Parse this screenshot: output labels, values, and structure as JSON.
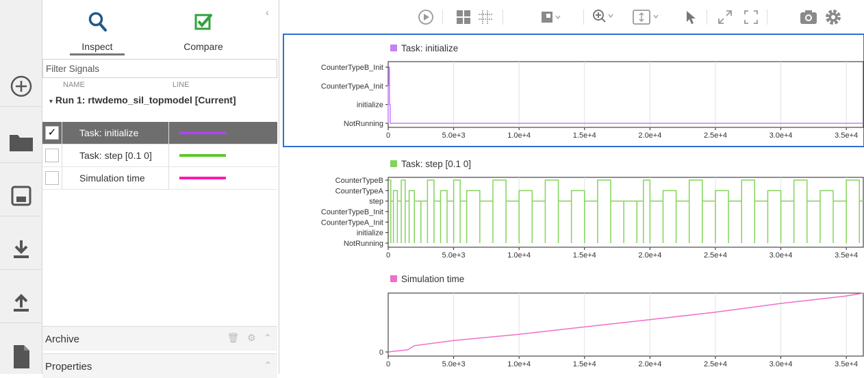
{
  "tabs": [
    {
      "label": "Inspect",
      "icon": "magnifier-icon"
    },
    {
      "label": "Compare",
      "icon": "checkbox-compare-icon"
    }
  ],
  "filter": {
    "placeholder": "Filter Signals"
  },
  "columns": {
    "name": "NAME",
    "line": "LINE"
  },
  "run": {
    "label": "Run 1: rtwdemo_sil_topmodel [Current]"
  },
  "signals": [
    {
      "name": "Task: initialize",
      "checked": true,
      "selected": true,
      "color": "#b044f0"
    },
    {
      "name": "Task: step [0.1 0]",
      "checked": false,
      "selected": false,
      "color": "#5cc92a"
    },
    {
      "name": "Simulation time",
      "checked": false,
      "selected": false,
      "color": "#ff1aa8"
    }
  ],
  "sections": {
    "archive": "Archive",
    "properties": "Properties"
  },
  "rail_icons": [
    "add-circle-icon",
    "folder-icon",
    "save-icon",
    "download-icon",
    "upload-icon",
    "document-icon"
  ],
  "toolbar_icons": [
    "play-icon",
    "layout-grid-icon",
    "subplot-layout-icon",
    "stream-visual-icon",
    "zoom-in-icon",
    "fit-to-view-icon",
    "cursor-icon",
    "expand-icon",
    "fullscreen-icon",
    "snapshot-icon",
    "settings-icon"
  ],
  "chart_data": [
    {
      "type": "line",
      "title": "Task: initialize",
      "color": "#c580f5",
      "selected": true,
      "xlim": [
        0,
        36300
      ],
      "x_ticks": [
        0,
        5000,
        10000,
        15000,
        20000,
        25000,
        30000,
        35000
      ],
      "x_tick_labels": [
        "0",
        "5.0e+3",
        "1.0e+4",
        "1.5e+4",
        "2.0e+4",
        "2.5e+4",
        "3.0e+4",
        "3.5e+4"
      ],
      "y_levels": [
        "NotRunning",
        "initialize",
        "CounterTypeA_Init",
        "CounterTypeB_Init"
      ],
      "y_tick_labels": [
        "NotRunning",
        "initialize",
        "CounterTypeA_Init",
        "CounterTypeB_Init"
      ],
      "series": [
        {
          "x": [
            0,
            0,
            50,
            50,
            100,
            100,
            150,
            150,
            36300
          ],
          "y": [
            0,
            2,
            2,
            3,
            3,
            1,
            1,
            0,
            0
          ]
        }
      ]
    },
    {
      "type": "line",
      "title": "Task: step [0.1 0]",
      "color": "#82d45a",
      "selected": false,
      "xlim": [
        0,
        36300
      ],
      "x_ticks": [
        0,
        5000,
        10000,
        15000,
        20000,
        25000,
        30000,
        35000
      ],
      "x_tick_labels": [
        "0",
        "5.0e+3",
        "1.0e+4",
        "1.5e+4",
        "2.0e+4",
        "2.5e+4",
        "3.0e+4",
        "3.5e+4"
      ],
      "y_levels": [
        "NotRunning",
        "initialize",
        "CounterTypeA_Init",
        "CounterTypeB_Init",
        "step",
        "CounterTypeA",
        "CounterTypeB"
      ],
      "y_tick_labels": [
        "NotRunning",
        "initialize",
        "CounterTypeA_Init",
        "CounterTypeB_Init",
        "step",
        "CounterTypeA",
        "CounterTypeB"
      ],
      "series": [
        {
          "x": [
            0,
            200,
            400,
            700,
            1000,
            1300,
            1600,
            2000,
            2500,
            3000,
            3500,
            4000,
            4500,
            5000,
            5500,
            6000,
            7000,
            8000,
            9000,
            10000,
            11000,
            12000,
            13000,
            14000,
            15000,
            16000,
            17000,
            18000,
            19000,
            19500,
            20000,
            21000,
            22000,
            23000,
            24000,
            25000,
            26000,
            27000,
            28000,
            29000,
            30000,
            31000,
            32000,
            33000,
            34000,
            35000,
            36000
          ],
          "y": [
            6,
            4,
            5,
            4,
            6,
            4,
            5,
            4,
            4,
            6,
            4,
            5,
            4,
            6,
            4,
            5,
            4,
            6,
            4,
            5,
            4,
            6,
            4,
            5,
            4,
            6,
            4,
            4,
            4,
            6,
            4,
            5,
            4,
            6,
            4,
            5,
            4,
            6,
            4,
            5,
            4,
            6,
            4,
            5,
            4,
            6,
            4
          ]
        }
      ]
    },
    {
      "type": "line",
      "title": "Simulation time",
      "color": "#f06ec8",
      "selected": false,
      "xlim": [
        0,
        36300
      ],
      "ylim": [
        0,
        40000
      ],
      "x_ticks": [
        0,
        5000,
        10000,
        15000,
        20000,
        25000,
        30000,
        35000
      ],
      "x_tick_labels": [
        "0",
        "5.0e+3",
        "1.0e+4",
        "1.5e+4",
        "2.0e+4",
        "2.5e+4",
        "3.0e+4",
        "3.5e+4"
      ],
      "y_ticks": [
        0
      ],
      "y_tick_labels": [
        "0"
      ],
      "series": [
        {
          "x": [
            0,
            500,
            1000,
            1500,
            2000,
            5000,
            10000,
            15000,
            20000,
            25000,
            30000,
            35000,
            36300
          ],
          "y": [
            0,
            500,
            1000,
            1500,
            4300,
            7800,
            12000,
            17000,
            22000,
            27000,
            33000,
            38000,
            40000
          ]
        }
      ]
    }
  ]
}
